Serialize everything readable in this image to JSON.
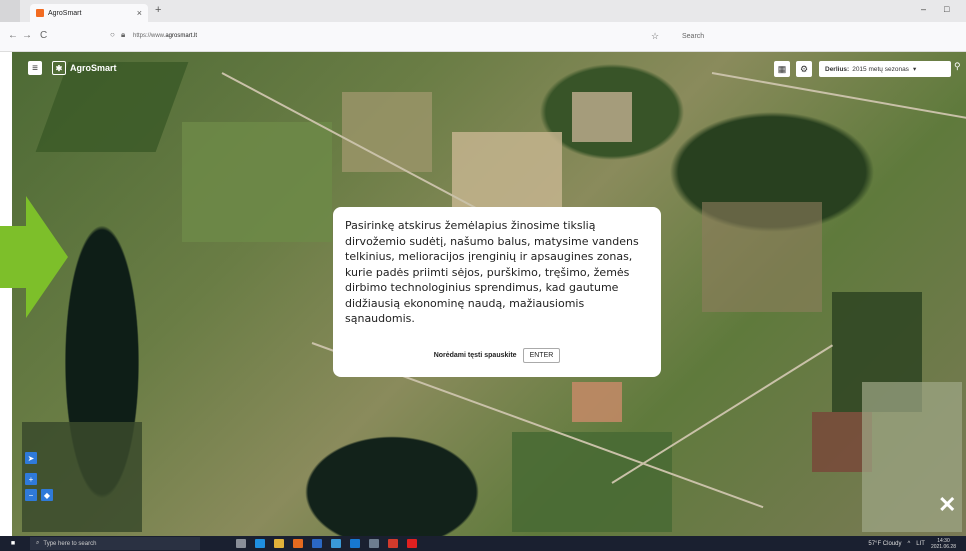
{
  "browser": {
    "tab_title": "AgroSmart",
    "tab_close": "×",
    "new_tab": "+",
    "url": "https://www.agrosmart.lt",
    "url_prefix": "https://www.",
    "url_domain": "agrosmart.lt",
    "search_placeholder": "Search",
    "back": "←",
    "forward": "→",
    "reload": "C",
    "star": "☆",
    "minimize": "–",
    "maximize": "□"
  },
  "app": {
    "menu_icon": "≡",
    "logo_text": "AgroSmart",
    "harvest_label": "Derlius:",
    "harvest_value": "2015 metų sezonas",
    "harvest_caret": "▾",
    "search_icon": "🔍",
    "pin_icon": "📍",
    "zoom_in": "+",
    "zoom_out": "−",
    "locate": "➤",
    "layer": "◆",
    "close": "✕"
  },
  "modal": {
    "text": "Pasirinkę atskirus žemėlapius žinosime tikslią dirvožemio sudėtį, našumo balus, matysime vandens telkinius, melioracijos įrenginių ir apsaugines zonas, kurie padės priimti sėjos, purškimo, tręšimo, žemės dirbimo technologinius sprendimus, kad gautume didžiausią ekonominę naudą, mažiausiomis sąnaudomis.",
    "continue_label": "Norėdami tęsti spauskite",
    "enter_button": "ENTER"
  },
  "taskbar": {
    "search_placeholder": "Type here to search",
    "weather": "57°F Cloudy",
    "lang": "LIT",
    "time": "14:30",
    "date": "2021.06.28"
  },
  "colors": {
    "accent_arrow": "#7dbf2a",
    "map_control": "#2f7ad9"
  }
}
